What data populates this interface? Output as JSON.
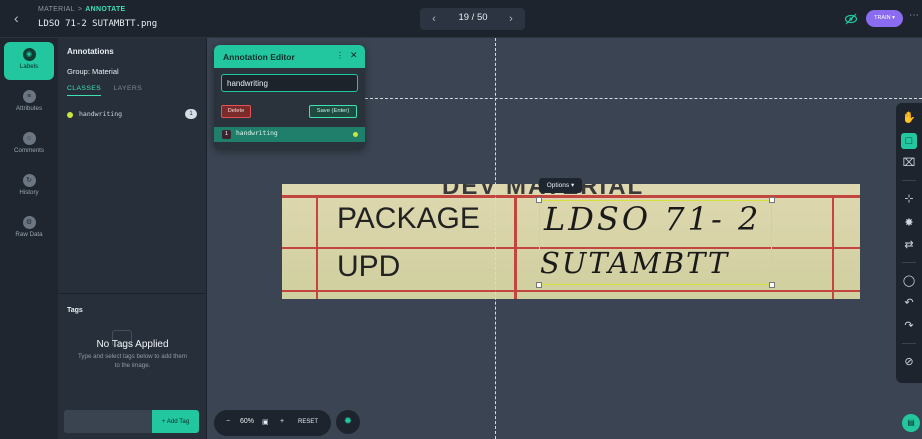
{
  "header": {
    "breadcrumb": {
      "parent": "MATERIAL",
      "separator": ">",
      "current": "ANNOTATE"
    },
    "filename": "LDSO 71-2 SUTAMBTT.png",
    "pager": {
      "current": 19,
      "total": 50,
      "text": "19 / 50"
    },
    "train_label": "TRAIN",
    "accent": "#22c7a0",
    "train_color": "#8b6cf0"
  },
  "rail": {
    "items": [
      {
        "label": "Labels",
        "icon": "tag-icon",
        "active": true
      },
      {
        "label": "Attributes",
        "icon": "sliders-icon",
        "active": false
      },
      {
        "label": "Comments",
        "icon": "comment-icon",
        "active": false
      },
      {
        "label": "History",
        "icon": "history-icon",
        "active": false
      },
      {
        "label": "Raw Data",
        "icon": "database-icon",
        "active": false
      }
    ]
  },
  "panel": {
    "title": "Annotations",
    "group": "Group: Material",
    "tabs": [
      {
        "label": "CLASSES",
        "active": true
      },
      {
        "label": "LAYERS",
        "active": false
      }
    ],
    "classes": [
      {
        "name": "handwriting",
        "count": "1",
        "color": "#c7e53c"
      }
    ],
    "tags": {
      "title": "Tags",
      "empty_title": "No Tags Applied",
      "empty_sub": "Type and select tags below to add them to the image.",
      "input_placeholder": "",
      "add_label": "+ Add Tag"
    }
  },
  "editor": {
    "title": "Annotation Editor",
    "input_value": "handwriting",
    "delete_label": "Delete",
    "save_label": "Save (Enter)",
    "row": {
      "index": "1",
      "label": "handwriting"
    }
  },
  "image": {
    "header_text": "DEV MATERIAL",
    "row1_label": "PACKAGE",
    "row2_label": "UPD",
    "row1_value": "LDSO 71- 2",
    "row2_value": "SUTAMBTT"
  },
  "options_label": "Options",
  "zoom": {
    "minus": "−",
    "level": "60%",
    "plus": "+",
    "reset": "RESET"
  }
}
